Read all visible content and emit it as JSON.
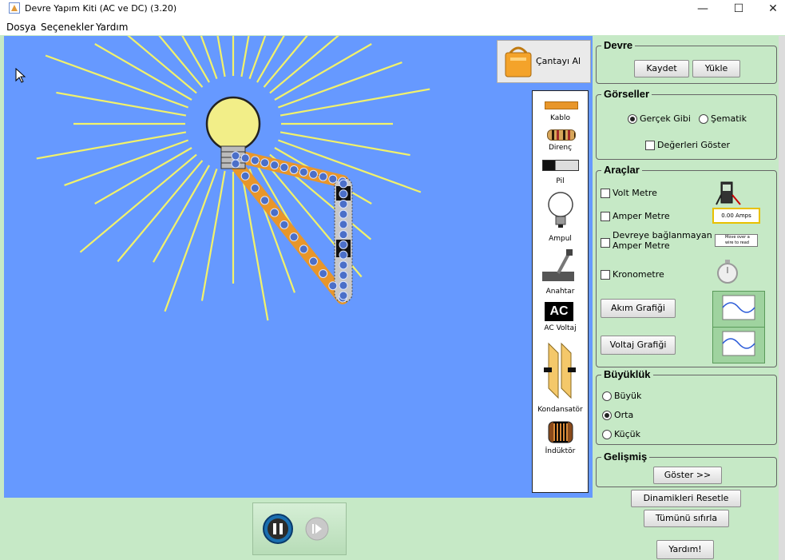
{
  "window": {
    "title": "Devre Yapım Kiti (AC ve DC) (3.20)",
    "minimize": "—",
    "maximize": "☐",
    "close": "✕"
  },
  "menu": [
    "Dosya",
    "Seçenekler",
    "Yardım"
  ],
  "bag_button": {
    "label": "Çantayı Al"
  },
  "toolbox": [
    "Kablo",
    "Direnç",
    "Pil",
    "Ampul",
    "Anahtar",
    "AC Voltaj",
    "Kondansatör",
    "İndüktör"
  ],
  "toolbox_ac_badge": "AC",
  "circuit": {
    "title": "Devre",
    "save_label": "Kaydet",
    "load_label": "Yükle"
  },
  "visuals": {
    "title": "Görseller",
    "options": [
      "Gerçek Gibi",
      "Şematik"
    ],
    "selected": "Gerçek Gibi",
    "show_values": "Değerleri Göster",
    "show_values_checked": false
  },
  "tools": {
    "title": "Araçlar",
    "voltmeter": "Volt Metre",
    "ammeter": "Amper Metre",
    "noncontact_line1": "Devreye bağlanmayan",
    "noncontact_line2": "Amper Metre",
    "stopwatch": "Kronometre",
    "current_graph": "Akım Grafiği",
    "voltage_graph": "Voltaj Grafiği",
    "ammeter_readout": "0.00 Amps",
    "noncontact_readout": "Move over a wire to read current"
  },
  "size": {
    "title": "Büyüklük",
    "options": [
      "Büyük",
      "Orta",
      "Küçük"
    ],
    "selected": "Orta"
  },
  "advanced": {
    "title": "Gelişmiş",
    "show_label": "Göster >>"
  },
  "reset_dynamics": "Dinamikleri Resetle",
  "reset_all": "Tümünü sıfırla",
  "help": "Yardım!",
  "colors": {
    "canvas": "#6699ff",
    "panel": "#c6e9c6",
    "wire": "#e8962a",
    "rays": "#f2f26a"
  }
}
